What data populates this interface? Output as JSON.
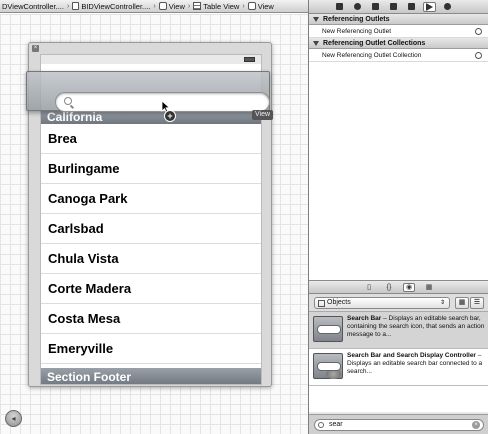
{
  "jump_bar": {
    "crumbs": [
      "DViewController....",
      "BIDViewController....",
      "View",
      "Table View",
      "View"
    ]
  },
  "canvas": {
    "section_header": "California",
    "rows": [
      "Brea",
      "Burlingame",
      "Canoga Park",
      "Carlsbad",
      "Chula Vista",
      "Corte Madera",
      "Costa Mesa",
      "Emeryville"
    ],
    "section_footer": "Section Footer",
    "drag_tooltip": "View",
    "drag_badge": "+",
    "back_glyph": "◂"
  },
  "connections": {
    "sections": [
      {
        "title": "Referencing Outlets",
        "rows": [
          "New Referencing Outlet"
        ]
      },
      {
        "title": "Referencing Outlet Collections",
        "rows": [
          "New Referencing Outlet Collection"
        ]
      }
    ]
  },
  "library": {
    "tabs": [
      "file-template-icon",
      "code-snippet-icon",
      "object-library-icon",
      "media-library-icon"
    ],
    "selected_tab_glyphs": [
      "▯",
      "{}",
      "◉",
      "▦"
    ],
    "selector_value": "Objects",
    "selector_arrows": "⇕",
    "view_buttons": [
      "▦",
      "☰"
    ],
    "items": [
      {
        "name": "Search Bar",
        "desc": " – Displays an editable search bar, containing the search icon, that sends an action message to a..."
      },
      {
        "name": "Search Bar and Search Display Controller",
        "desc": " – Displays an editable search bar connected to a search..."
      }
    ],
    "filter_value": "sear",
    "filter_clear": "×"
  },
  "colors": {
    "section_bar": "#7d848c",
    "pane_bg": "#e8e8e8"
  }
}
